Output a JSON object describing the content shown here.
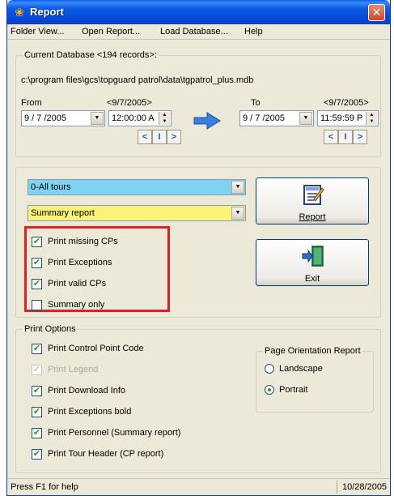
{
  "window": {
    "title": "Report",
    "close_glyph": "✕",
    "icon": "report-app-icon"
  },
  "menu": [
    "Folder View...",
    "Open Report...",
    "Load Database...",
    "Help"
  ],
  "database": {
    "group_title": "Current Database <194 records>:",
    "path": "c:\\program files\\gcs\\topguard patrol\\data\\tgpatrol_plus.mdb",
    "from_label": "From",
    "from_hint": "<9/7/2005>",
    "from_date": "9 / 7 /2005",
    "from_time": "12:00:00 A",
    "to_label": "To",
    "to_hint": "<9/7/2005>",
    "to_date": "9 / 7 /2005",
    "to_time": "11:59:59 P",
    "nav": [
      "<",
      "I",
      ">"
    ]
  },
  "selection": {
    "tour": "0-All tours",
    "tour_color": "#7fd3f0",
    "report_type": "Summary report",
    "report_type_color": "#fbf27a",
    "checks": [
      {
        "label": "Print missing CPs",
        "checked": true
      },
      {
        "label": "Print Exceptions",
        "checked": true
      },
      {
        "label": "Print valid CPs",
        "checked": true
      },
      {
        "label": "Summary only",
        "checked": false
      }
    ],
    "highlight_color": "#e51f1f"
  },
  "buttons": {
    "report_label": "Report",
    "exit_label": "Exit"
  },
  "print_options": {
    "group_title": "Print Options",
    "items": [
      {
        "label": "Print Control Point Code",
        "checked": true,
        "disabled": false
      },
      {
        "label": "Print Legend",
        "checked": true,
        "disabled": true
      },
      {
        "label": "Print Download Info",
        "checked": true,
        "disabled": false
      },
      {
        "label": "Print Exceptions bold",
        "checked": true,
        "disabled": false
      },
      {
        "label": "Print Personnel (Summary report)",
        "checked": true,
        "disabled": false
      },
      {
        "label": "Print Tour Header (CP report)",
        "checked": true,
        "disabled": false
      }
    ],
    "orientation": {
      "title": "Page Orientation Report",
      "options": [
        "Landscape",
        "Portrait"
      ],
      "selected": "Portrait"
    }
  },
  "status": {
    "help": "Press F1 for help",
    "date": "10/28/2005"
  },
  "check_glyph": "✔"
}
